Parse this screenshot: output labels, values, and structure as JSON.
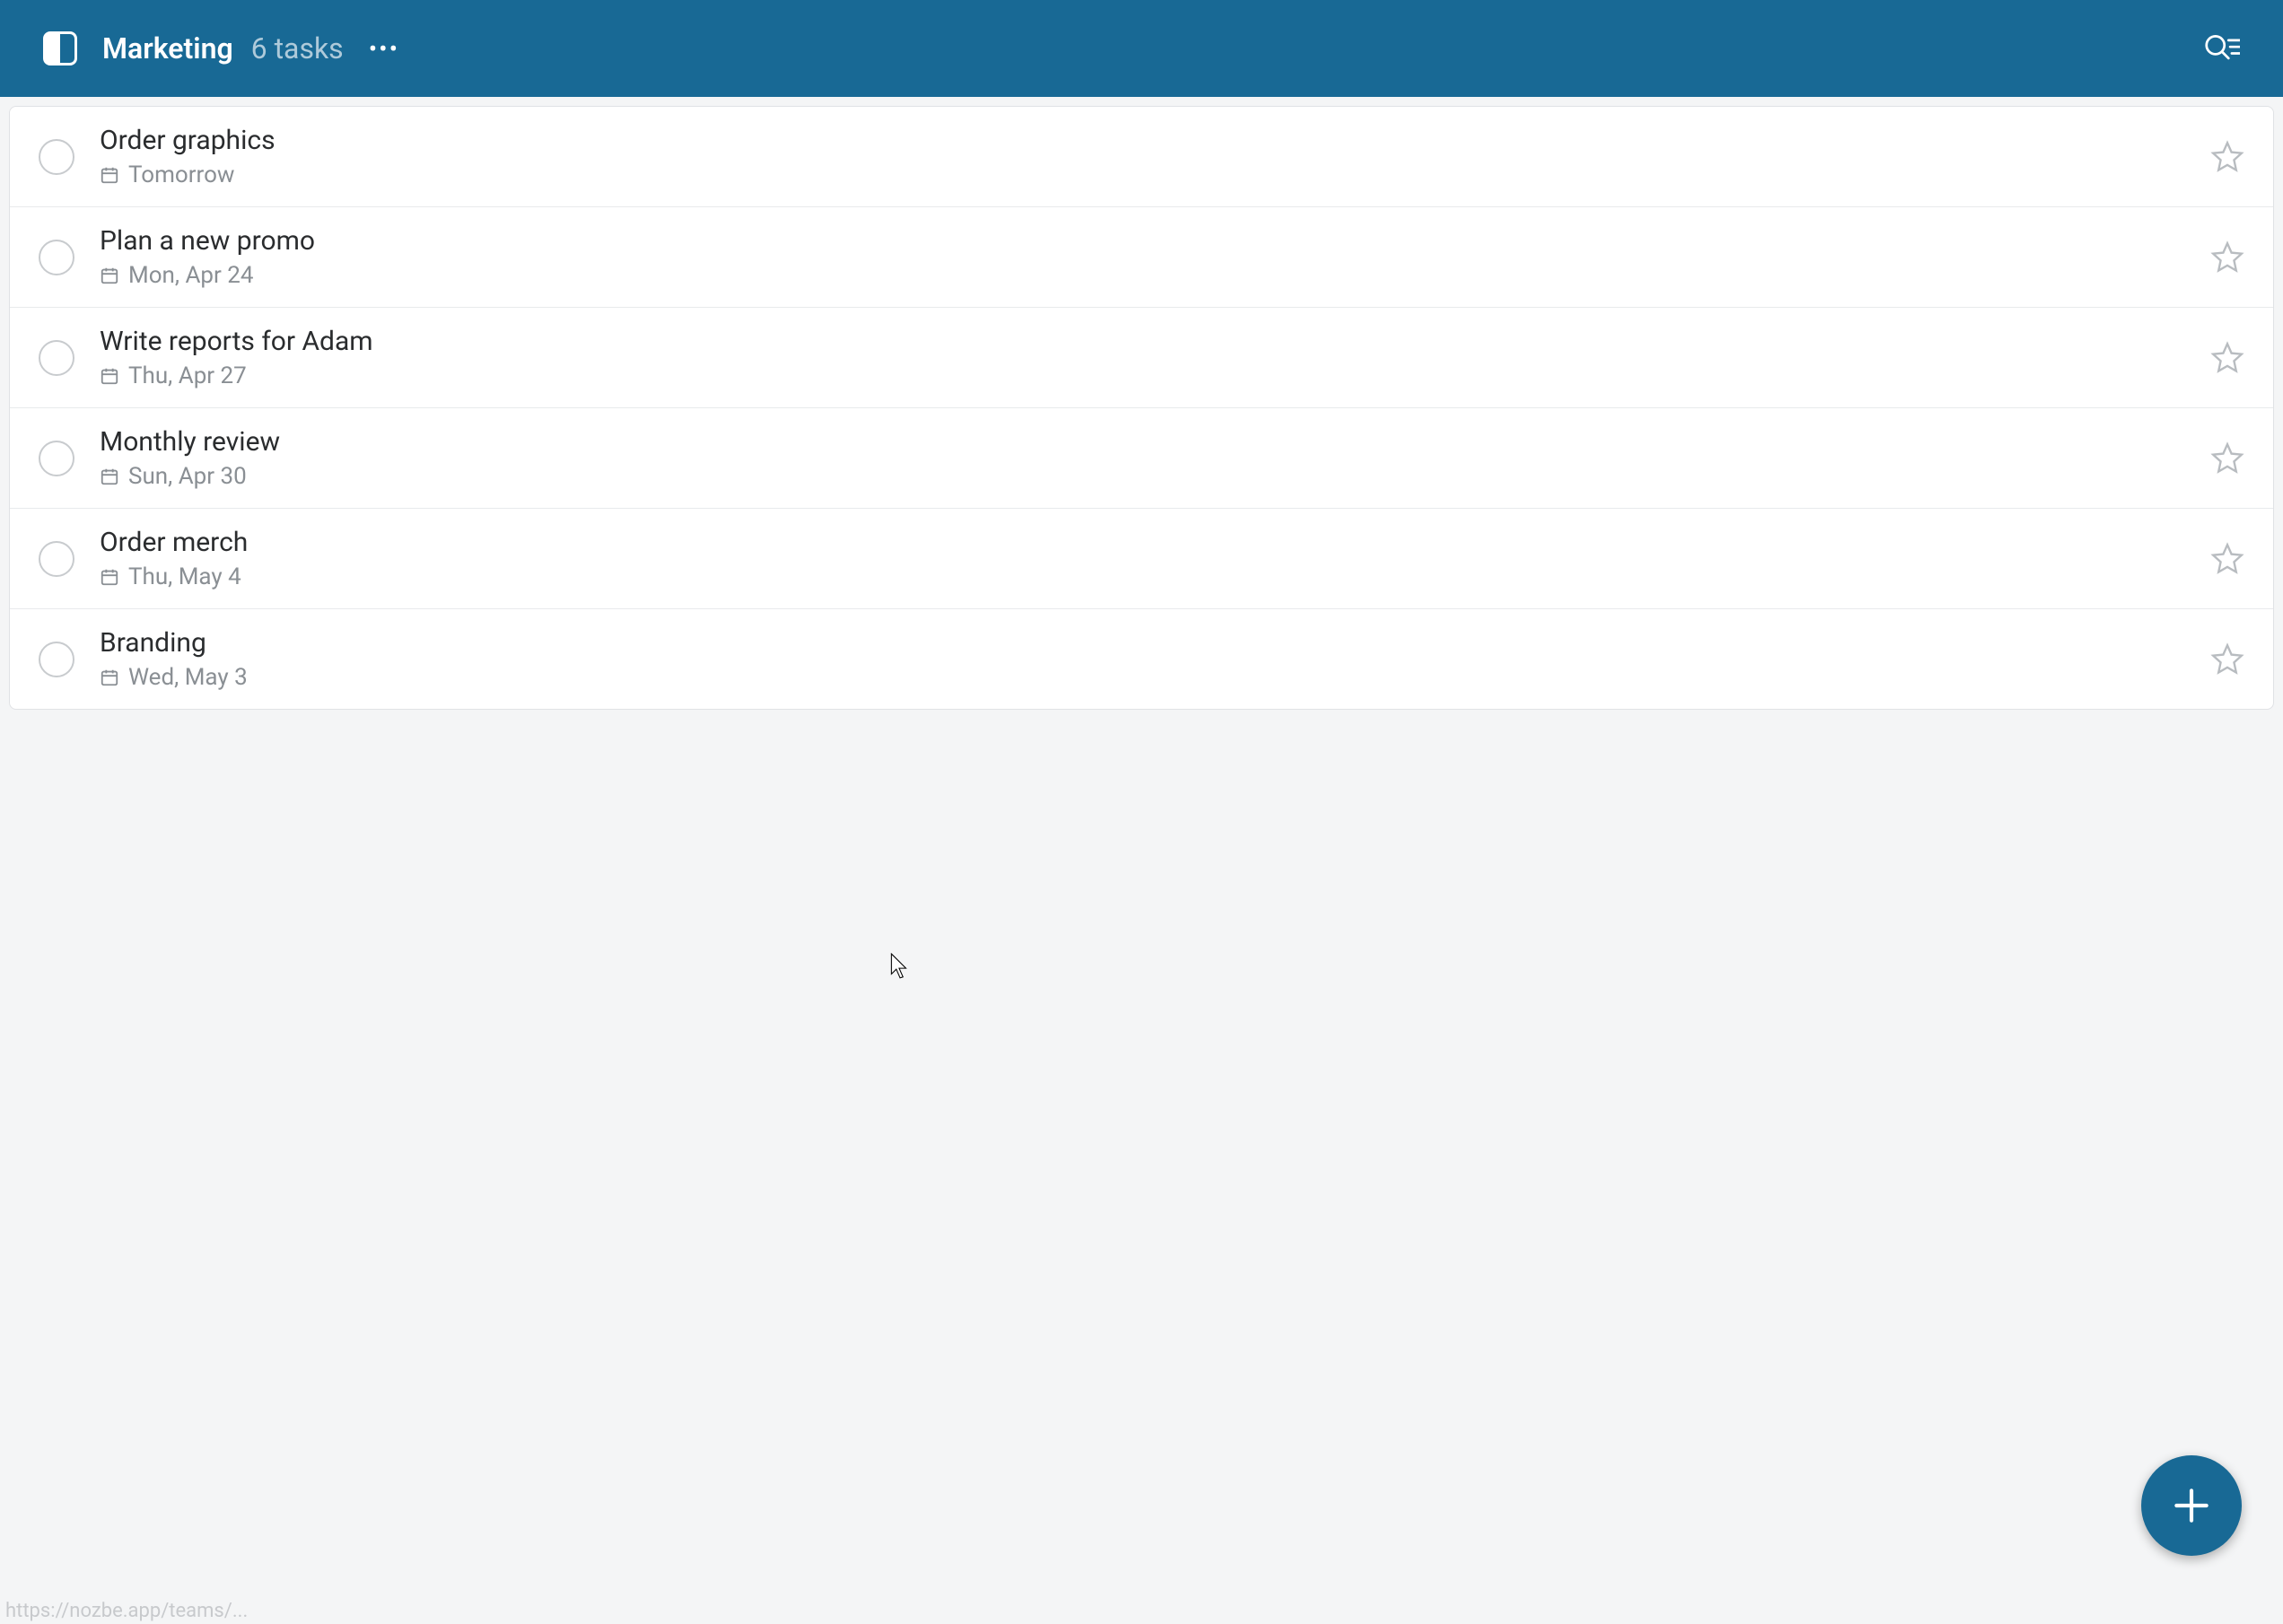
{
  "header": {
    "title": "Marketing",
    "task_count": "6 tasks"
  },
  "tasks": [
    {
      "title": "Order graphics",
      "date": "Tomorrow"
    },
    {
      "title": "Plan a new promo",
      "date": "Mon, Apr 24"
    },
    {
      "title": "Write reports for Adam",
      "date": "Thu, Apr 27"
    },
    {
      "title": "Monthly review",
      "date": "Sun, Apr 30"
    },
    {
      "title": "Order merch",
      "date": "Thu, May 4"
    },
    {
      "title": "Branding",
      "date": "Wed, May 3"
    }
  ],
  "status_url": "https://nozbe.app/teams/..."
}
